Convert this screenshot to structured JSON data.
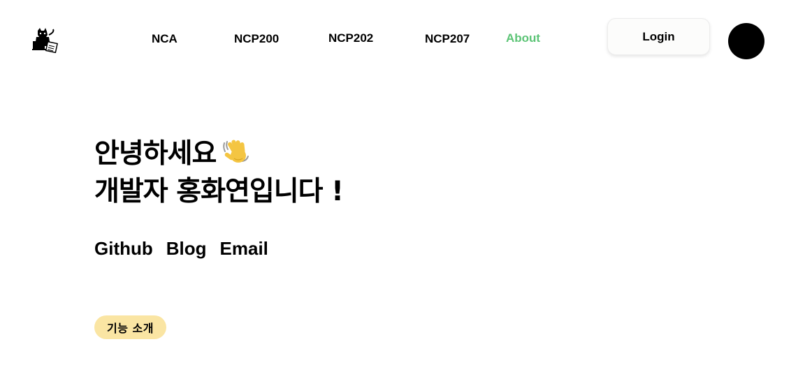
{
  "header": {
    "logo_icon": "cat-with-laptop-icon",
    "nav": [
      {
        "label": "NCA",
        "active": false
      },
      {
        "label": "NCP200",
        "active": false
      },
      {
        "label": "NCP202",
        "active": false
      },
      {
        "label": "NCP207",
        "active": false
      },
      {
        "label": "About",
        "active": true
      }
    ],
    "login_label": "Login",
    "avatar_icon": "coffee-icon",
    "avatar_glyph": "☕"
  },
  "hero": {
    "greeting_line1": "안녕하세요",
    "wave_icon": "waving-hand-icon",
    "greeting_line2": "개발자 홍화연입니다 !",
    "links": {
      "github": "Github",
      "blog": "Blog",
      "email": "Email"
    },
    "badge": "기능 소개"
  },
  "colors": {
    "accent": "#5cc476",
    "badge_bg": "#fae5a3",
    "avatar_bg": "#000000",
    "text": "#000000"
  }
}
